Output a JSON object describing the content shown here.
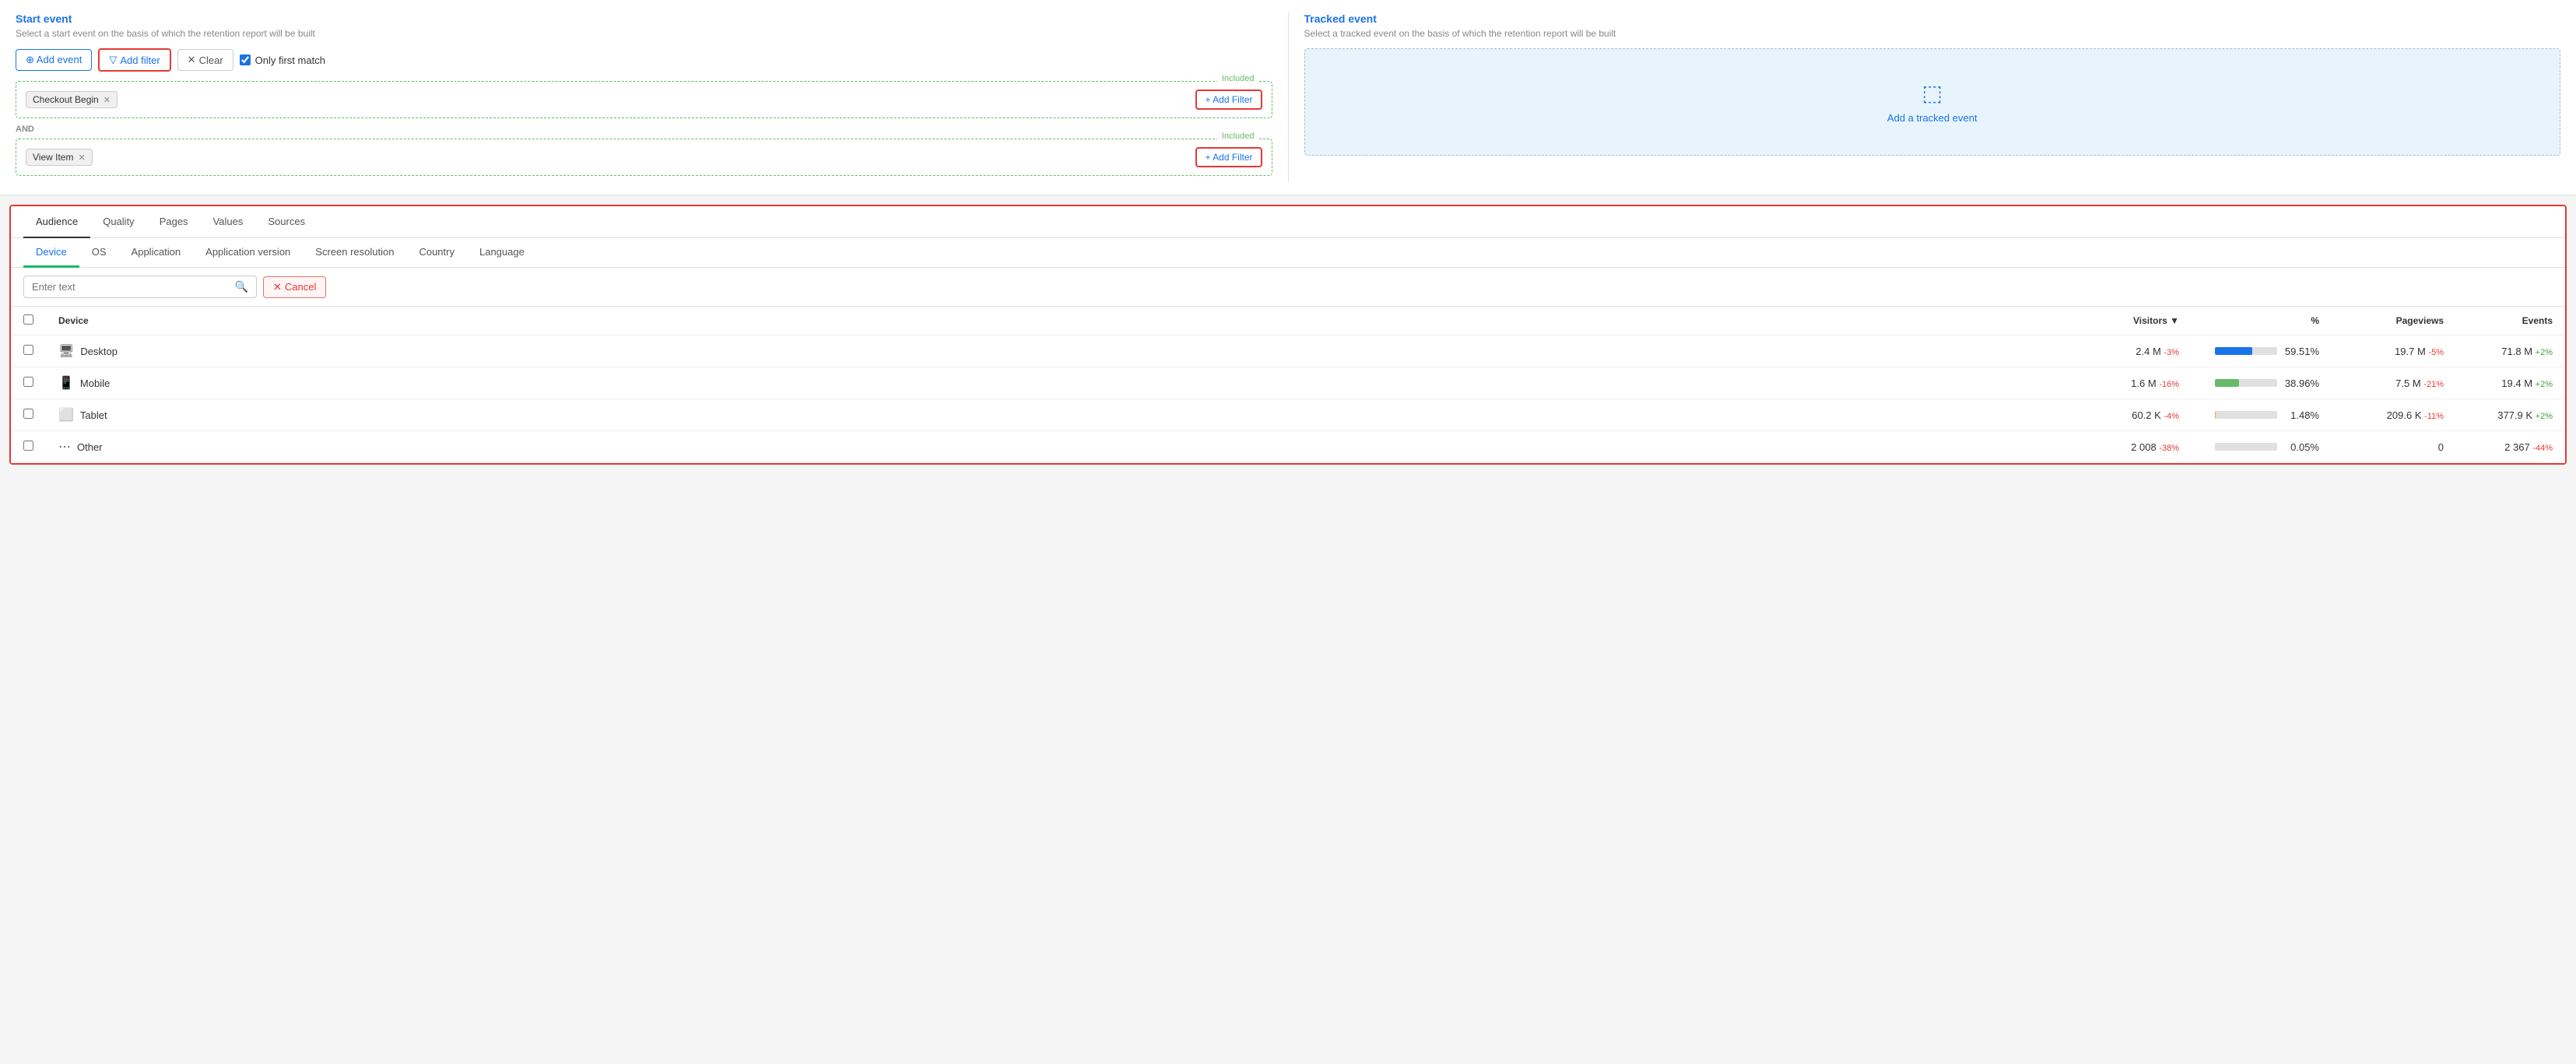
{
  "start_event": {
    "title": "Start event",
    "subtitle": "Select a start event on the basis of which the retention report will be built",
    "toolbar": {
      "add_event": "⊕ Add event",
      "add_filter": "Add filter",
      "clear": "Clear",
      "only_first_match": "Only first match"
    },
    "groups": [
      {
        "label": "Included",
        "tag": "Checkout Begin",
        "add_filter_btn": "+ Add Filter"
      },
      {
        "label": "Included",
        "tag": "View Item",
        "add_filter_btn": "+ Add Filter"
      }
    ],
    "and_label": "AND"
  },
  "tracked_event": {
    "title": "Tracked event",
    "subtitle": "Select a tracked event on the basis of which the retention report will be built",
    "add_label": "Add a tracked event"
  },
  "bottom": {
    "main_tabs": [
      {
        "label": "Audience",
        "active": true
      },
      {
        "label": "Quality",
        "active": false
      },
      {
        "label": "Pages",
        "active": false
      },
      {
        "label": "Values",
        "active": false
      },
      {
        "label": "Sources",
        "active": false
      }
    ],
    "sub_tabs": [
      {
        "label": "Device",
        "active": true
      },
      {
        "label": "OS",
        "active": false
      },
      {
        "label": "Application",
        "active": false
      },
      {
        "label": "Application version",
        "active": false
      },
      {
        "label": "Screen resolution",
        "active": false
      },
      {
        "label": "Country",
        "active": false
      },
      {
        "label": "Language",
        "active": false
      }
    ],
    "search_placeholder": "Enter text",
    "cancel_btn": "Cancel",
    "table": {
      "headers": [
        "Device",
        "Visitors ▼",
        "%",
        "Pageviews",
        "Events"
      ],
      "rows": [
        {
          "device": "Desktop",
          "device_icon": "🖥",
          "visitors": "2.4 M",
          "visitors_delta": "-3%",
          "visitors_delta_type": "neg",
          "pct": "59.51%",
          "pct_value": 59.51,
          "pageviews": "19.7 M",
          "pageviews_delta": "-5%",
          "pageviews_delta_type": "neg",
          "events": "71.8 M",
          "events_delta": "+2%",
          "events_delta_type": "pos"
        },
        {
          "device": "Mobile",
          "device_icon": "📱",
          "visitors": "1.6 M",
          "visitors_delta": "-16%",
          "visitors_delta_type": "neg",
          "pct": "38.96%",
          "pct_value": 38.96,
          "pageviews": "7.5 M",
          "pageviews_delta": "-21%",
          "pageviews_delta_type": "neg",
          "events": "19.4 M",
          "events_delta": "+2%",
          "events_delta_type": "pos"
        },
        {
          "device": "Tablet",
          "device_icon": "⬜",
          "visitors": "60.2 K",
          "visitors_delta": "-4%",
          "visitors_delta_type": "neg",
          "pct": "1.48%",
          "pct_value": 1.48,
          "pageviews": "209.6 K",
          "pageviews_delta": "-11%",
          "pageviews_delta_type": "neg",
          "events": "377.9 K",
          "events_delta": "+2%",
          "events_delta_type": "pos"
        },
        {
          "device": "Other",
          "device_icon": "⋯",
          "visitors": "2 008",
          "visitors_delta": "-38%",
          "visitors_delta_type": "neg",
          "pct": "0.05%",
          "pct_value": 0.05,
          "pageviews": "0",
          "pageviews_delta": "",
          "pageviews_delta_type": "",
          "events": "2 367",
          "events_delta": "-44%",
          "events_delta_type": "neg"
        }
      ]
    }
  }
}
